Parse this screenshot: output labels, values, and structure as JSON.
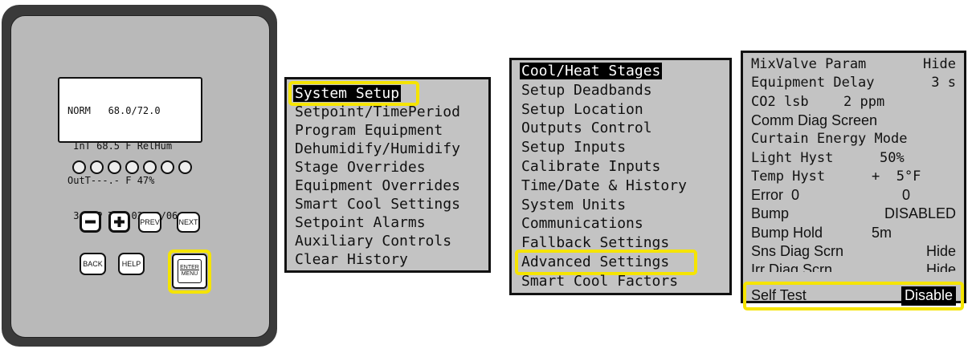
{
  "controller": {
    "lcd_lines": [
      "NORM   68.0/72.0",
      " InT 68.5 F RelHum",
      "OutT---.- F 47%",
      " 3:30P Tue 02/19/06"
    ],
    "led_count": 7,
    "keys": {
      "minus": "−",
      "plus": "+",
      "prev": "PREV",
      "next": "NEXT",
      "back": "BACK",
      "help": "HELP",
      "enter_top": "ENTER",
      "enter_bottom": "MENU"
    }
  },
  "menu_main": {
    "items": [
      "System Setup",
      "Setpoint/TimePeriod",
      "Program Equipment",
      "Dehumidify/Humidify",
      "Stage Overrides",
      "Equipment Overrides",
      "Smart Cool Settings",
      "Setpoint Alarms",
      "Auxiliary Controls",
      "Clear History"
    ],
    "selected_index": 0,
    "highlighted_index": 0
  },
  "menu_system_setup": {
    "items": [
      "Cool/Heat Stages",
      "Setup Deadbands",
      "Setup Location",
      "Outputs Control",
      "Setup Inputs",
      "Calibrate Inputs",
      "Time/Date & History",
      "System Units",
      "Communications",
      "Fallback Settings",
      "Advanced Settings",
      "Smart Cool Factors"
    ],
    "selected_index": 0,
    "highlighted_index": 10
  },
  "menu_advanced": {
    "rows": [
      {
        "label": "MixValve Param",
        "value": "Hide"
      },
      {
        "label": "Equipment Delay",
        "value": "3 s"
      },
      {
        "label": "CO2 lsb",
        "value": "2 ppm"
      },
      {
        "label": "Comm Diag Screen",
        "value": ""
      },
      {
        "label": "Curtain Energy Mode",
        "value": ""
      },
      {
        "label": "Light Hyst",
        "value": "50%"
      },
      {
        "label": "Temp Hyst",
        "value": "+  5°F"
      },
      {
        "label": "Error  0",
        "value": "0"
      },
      {
        "label": "Bump",
        "value": "DISABLED"
      },
      {
        "label": "Bump Hold",
        "value": "5m"
      },
      {
        "label": "Sns Diag Scrn",
        "value": "Hide"
      },
      {
        "label": "Irr Diag Scrn",
        "value": "Hide"
      },
      {
        "label": "Self Test",
        "value": "Disable"
      }
    ],
    "highlighted_index": 12
  },
  "colors": {
    "highlight": "#f5e400",
    "menu_background": "#c3c3c3",
    "panel_face": "#b9b9b9"
  }
}
